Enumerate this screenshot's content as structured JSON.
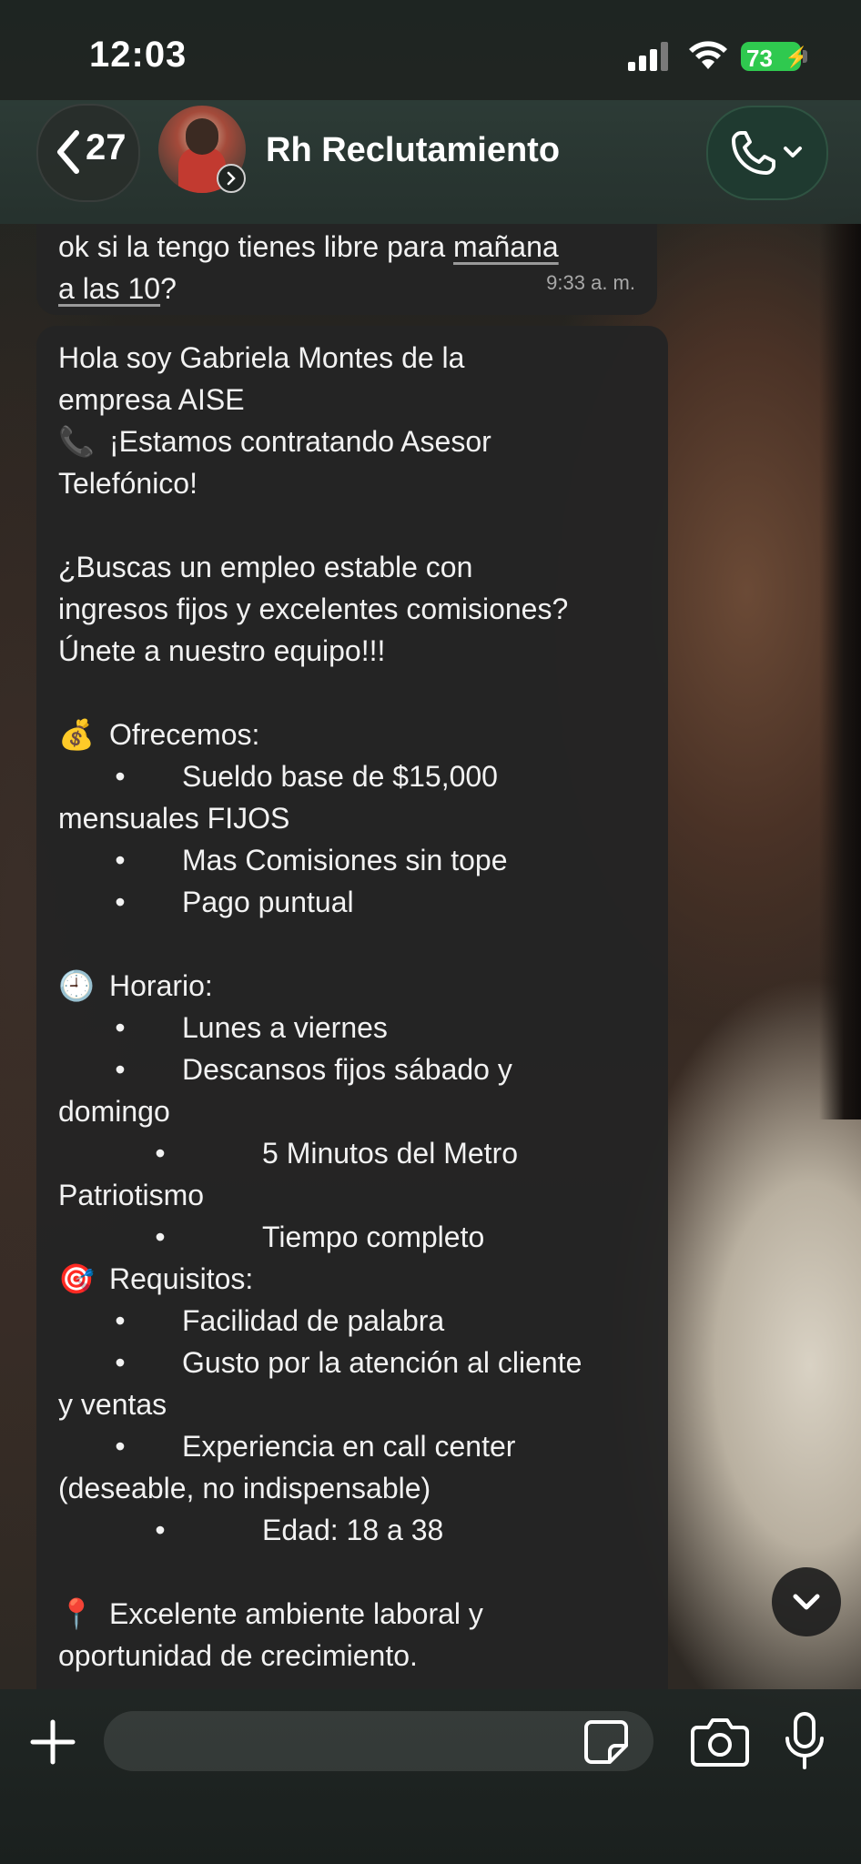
{
  "status_bar": {
    "time": "12:03",
    "battery": "73"
  },
  "header": {
    "back_count": "27",
    "contact_name": "Rh Reclutamiento"
  },
  "messages": [
    {
      "lines": [
        "ok si la tengo tienes libre para mañana",
        "a las 10?"
      ],
      "underlined": [
        "mañana",
        "a las 10"
      ],
      "time": "9:33 a. m."
    },
    {
      "lines": [
        {
          "text": "Hola soy Gabriela Montes de la"
        },
        {
          "text": "empresa AISE"
        },
        {
          "emoji": "📞",
          "text": "¡Estamos contratando Asesor"
        },
        {
          "text": "Telefónico!"
        },
        {
          "blank": true
        },
        {
          "text": "¿Buscas un empleo estable con"
        },
        {
          "text": "ingresos fijos y excelentes comisiones?"
        },
        {
          "text": "Únete a nuestro equipo!!!"
        },
        {
          "blank": true
        },
        {
          "emoji": "💰",
          "text": "Ofrecemos:"
        },
        {
          "bullet": "•",
          "text": "Sueldo base de $15,000"
        },
        {
          "text": "mensuales FIJOS"
        },
        {
          "bullet": "•",
          "text": "Mas Comisiones sin tope"
        },
        {
          "bullet": "•",
          "text": "Pago puntual"
        },
        {
          "blank": true
        },
        {
          "emoji": "🕘",
          "text": "Horario:"
        },
        {
          "bullet": "•",
          "text": "Lunes a viernes"
        },
        {
          "bullet": "•",
          "text": "Descansos fijos sábado y"
        },
        {
          "text": "domingo"
        },
        {
          "bullet_wide": "•",
          "text": "5 Minutos del Metro"
        },
        {
          "text": "Patriotismo"
        },
        {
          "bullet_wide": "•",
          "text": "Tiempo completo"
        },
        {
          "emoji": "🎯",
          "text": "Requisitos:"
        },
        {
          "bullet": "•",
          "text": "Facilidad de palabra"
        },
        {
          "bullet": "•",
          "text": "Gusto por la atención al cliente"
        },
        {
          "text": "y ventas"
        },
        {
          "bullet": "•",
          "text": "Experiencia en call center"
        },
        {
          "text": "(deseable, no indispensable)"
        },
        {
          "bullet_wide": "•",
          "text": "Edad: 18 a 38"
        },
        {
          "blank": true
        },
        {
          "emoji": "📍",
          "text": "Excelente ambiente laboral y"
        },
        {
          "text": "oportunidad de crecimiento."
        }
      ]
    }
  ],
  "input": {
    "placeholder": ""
  },
  "icons": {
    "back": "chevron-left-icon",
    "call": "phone-icon",
    "scroll": "chevron-down-icon",
    "plus": "plus-icon",
    "sticker": "sticker-icon",
    "camera": "camera-icon",
    "mic": "microphone-icon"
  },
  "colors": {
    "battery": "#2fc94f",
    "bubble": "#242424",
    "call_button": "#1f3a30"
  }
}
